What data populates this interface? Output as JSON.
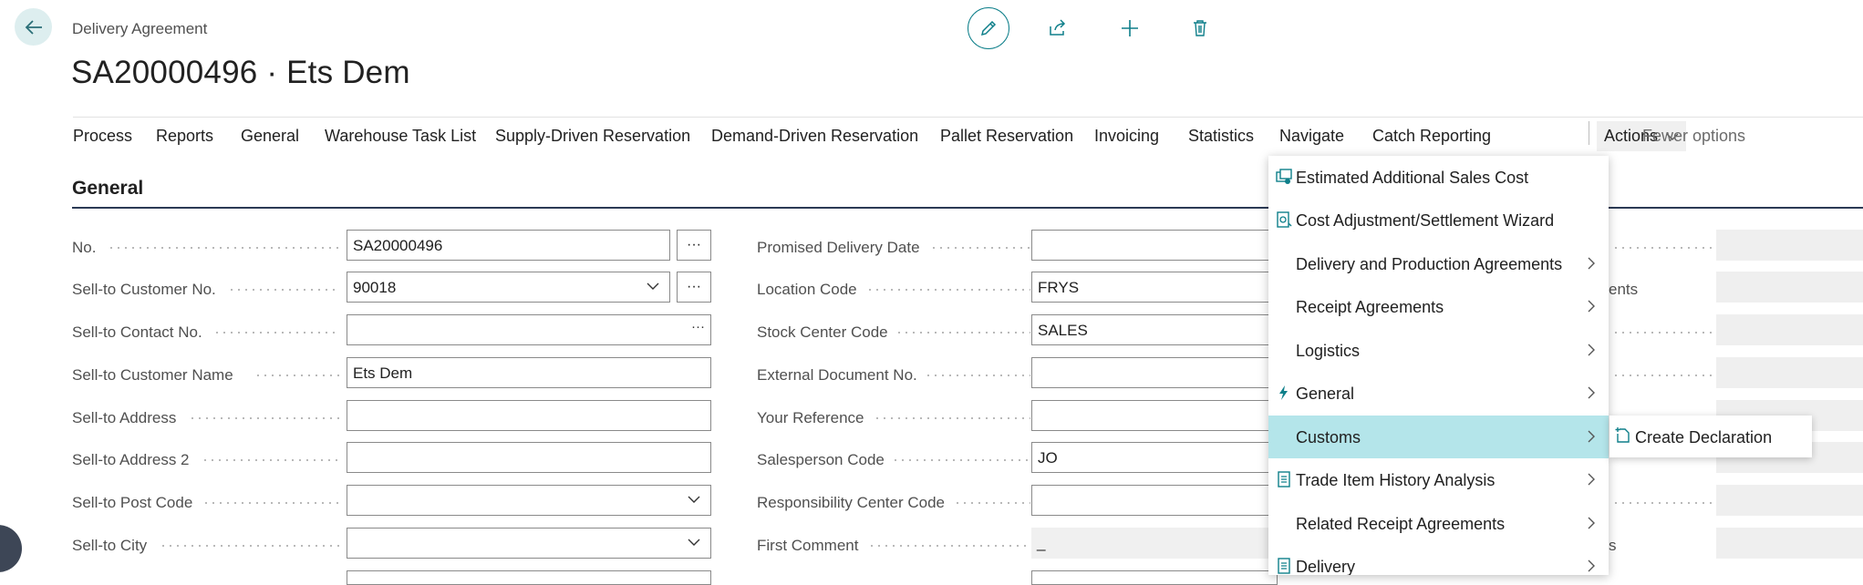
{
  "header": {
    "caption": "Delivery Agreement",
    "title": "SA20000496 · Ets Dem"
  },
  "tabs": [
    "Process",
    "Reports",
    "General",
    "Warehouse Task List",
    "Supply-Driven Reservation",
    "Demand-Driven Reservation",
    "Pallet Reservation",
    "Invoicing",
    "Statistics",
    "Navigate",
    "Catch Reporting",
    "Actions",
    "Fewer options"
  ],
  "section": {
    "title": "General"
  },
  "fields_left": [
    {
      "label": "No.",
      "value": "SA20000496"
    },
    {
      "label": "Sell-to Customer No.",
      "value": "90018"
    },
    {
      "label": "Sell-to Contact No.",
      "value": ""
    },
    {
      "label": "Sell-to Customer Name",
      "value": "Ets Dem"
    },
    {
      "label": "Sell-to Address",
      "value": ""
    },
    {
      "label": "Sell-to Address 2",
      "value": ""
    },
    {
      "label": "Sell-to Post Code",
      "value": ""
    },
    {
      "label": "Sell-to City",
      "value": ""
    }
  ],
  "fields_mid": [
    {
      "label": "Promised Delivery Date",
      "value": ""
    },
    {
      "label": "Location Code",
      "value": "FRYS"
    },
    {
      "label": "Stock Center Code",
      "value": "SALES"
    },
    {
      "label": "External Document No.",
      "value": ""
    },
    {
      "label": "Your Reference",
      "value": ""
    },
    {
      "label": "Salesperson Code",
      "value": "JO"
    },
    {
      "label": "Responsibility Center Code",
      "value": ""
    },
    {
      "label": "First Comment",
      "value": "_"
    }
  ],
  "partial_right": {
    "label_1": "ents",
    "label_7": "s"
  },
  "actions_menu": {
    "items": [
      {
        "label": "Estimated Additional Sales Cost",
        "icon": "cost-estimate-icon"
      },
      {
        "label": "Cost Adjustment/Settlement Wizard",
        "icon": "wizard-icon"
      },
      {
        "label": "Delivery and Production Agreements",
        "has_submenu": true
      },
      {
        "label": "Receipt Agreements",
        "has_submenu": true
      },
      {
        "label": "Logistics",
        "has_submenu": true
      },
      {
        "label": "General",
        "icon": "lightning-icon",
        "has_submenu": true
      },
      {
        "label": "Customs",
        "has_submenu": true,
        "active": true
      },
      {
        "label": "Trade Item History Analysis",
        "icon": "document-icon",
        "has_submenu": true
      },
      {
        "label": "Related Receipt Agreements",
        "has_submenu": true
      },
      {
        "label": "Delivery",
        "icon": "document-icon",
        "has_submenu": true
      }
    ],
    "submenu": {
      "label": "Create Declaration",
      "icon": "new-document-icon"
    }
  },
  "colors": {
    "accent": "#0e7f8a",
    "active_item": "#b4e5ea",
    "section_rule": "#2b3a55"
  }
}
